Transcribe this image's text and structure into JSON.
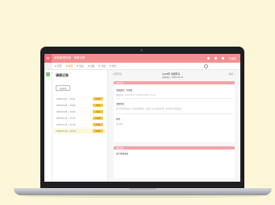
{
  "app": {
    "logo_glyph": "≡",
    "title": "考勤管理系统 · 请假记录",
    "user": "管理员"
  },
  "nav": {
    "tabs": [
      {
        "label": "首页"
      },
      {
        "label": "请假"
      },
      {
        "label": "加班"
      },
      {
        "label": "出差"
      },
      {
        "label": "外出"
      },
      {
        "label": "统计"
      }
    ],
    "active_index": 1
  },
  "list": {
    "title": "请假记录",
    "filter_label": "全部状态",
    "rows": [
      {
        "date": "2018-03-01 ~ 03-02",
        "status": "待审批"
      },
      {
        "date": "2018-03-05 ~ 03-06",
        "status": "待审批"
      },
      {
        "date": "2018-03-08 ~ 03-09",
        "status": "待审批"
      },
      {
        "date": "2018-03-12 ~ 03-13",
        "status": "待审批"
      },
      {
        "date": "2018-03-15 ~ 03-16",
        "status": "待审批"
      },
      {
        "date": "2018-03-19 ~ 03-20",
        "status": "待审批"
      }
    ],
    "selected_index": 5
  },
  "detail": {
    "breadcrumb": "< 返回列表",
    "header_title": "2018年 请假申请",
    "header_sub": "申请时间：2018-03-19",
    "action": "撤销 >",
    "sections": [
      {
        "bar": "请假信息",
        "fields": [
          {
            "label": "请假类型：年休假",
            "value": "请假时间：2018-03-19 至 2018-03-20，共 2 天"
          },
          {
            "label": "请假事由",
            "value": "家中有事需要处理，申请年休假两天，期间工作已交接给同事，紧急事务可电话联系。"
          },
          {
            "label": "附件",
            "value": "暂无附件"
          }
        ]
      },
      {
        "bar": "审批流程",
        "fields": [
          {
            "label": "部门经理审批",
            "value": ""
          }
        ]
      }
    ]
  }
}
